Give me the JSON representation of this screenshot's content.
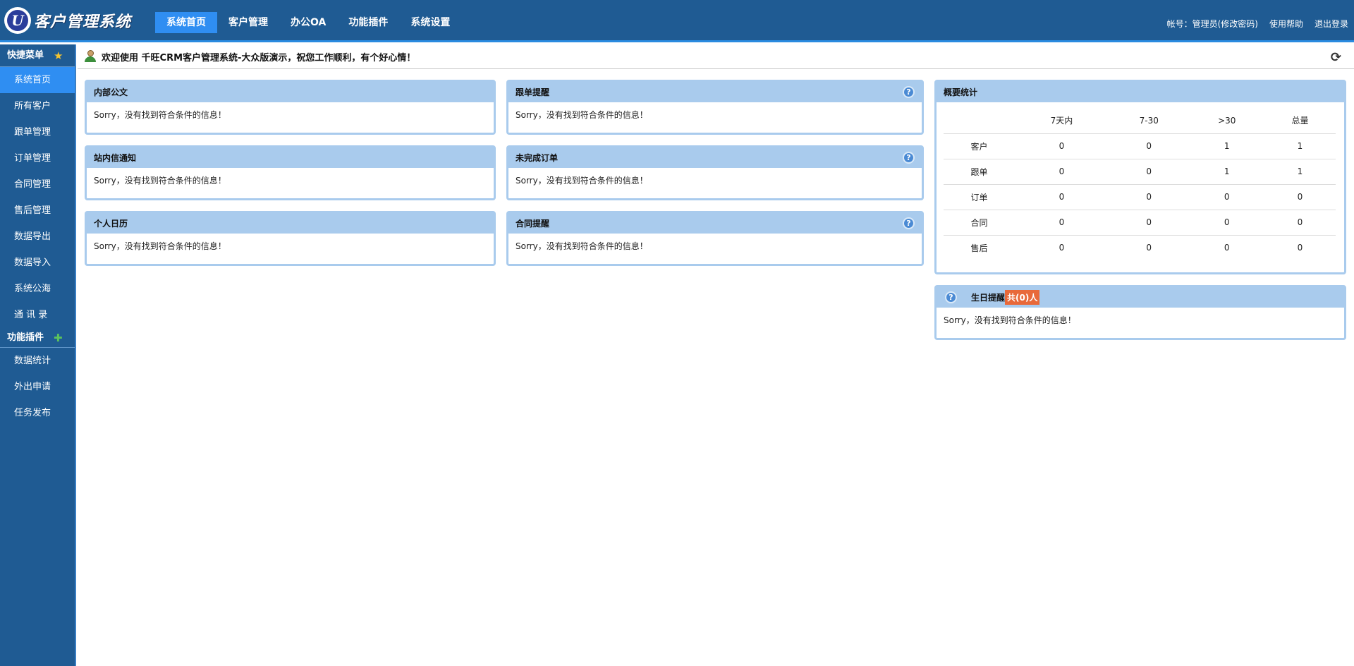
{
  "header": {
    "logo_text": "客户管理系统",
    "logo_letter": "U",
    "nav": [
      "系统首页",
      "客户管理",
      "办公OA",
      "功能插件",
      "系统设置"
    ],
    "account": "帐号：管理员(修改密码)",
    "help": "使用帮助",
    "logout": "退出登录"
  },
  "sidebar": {
    "quick_menu_title": "快捷菜单",
    "quick_items": [
      "系统首页",
      "所有客户",
      "跟单管理",
      "订单管理",
      "合同管理",
      "售后管理",
      "数据导出",
      "数据导入",
      "系统公海",
      "通 讯 录"
    ],
    "plugins_title": "功能插件",
    "plugin_items": [
      "数据统计",
      "外出申请",
      "任务发布"
    ]
  },
  "welcome": {
    "text": "欢迎使用 千旺CRM客户管理系统-大众版演示，祝您工作顺利，有个好心情！"
  },
  "panels": {
    "internal_docs": {
      "title": "内部公文",
      "body": "Sorry，没有找到符合条件的信息！"
    },
    "followup_reminder": {
      "title": "跟单提醒",
      "body": "Sorry，没有找到符合条件的信息！"
    },
    "site_messages": {
      "title": "站内信通知",
      "body": "Sorry，没有找到符合条件的信息！"
    },
    "unfinished_orders": {
      "title": "未完成订单",
      "body": "Sorry，没有找到符合条件的信息！"
    },
    "personal_calendar": {
      "title": "个人日历",
      "body": "Sorry，没有找到符合条件的信息！"
    },
    "contract_reminder": {
      "title": "合同提醒",
      "body": "Sorry，没有找到符合条件的信息！"
    },
    "birthday": {
      "title": "生日提醒",
      "badge": "共(0)人",
      "body": "Sorry，没有找到符合条件的信息！"
    }
  },
  "stats": {
    "title": "概要统计",
    "columns": [
      "",
      "7天内",
      "7-30",
      ">30",
      "总量"
    ],
    "rows": [
      [
        "客户",
        "0",
        "0",
        "1",
        "1"
      ],
      [
        "跟单",
        "0",
        "0",
        "1",
        "1"
      ],
      [
        "订单",
        "0",
        "0",
        "0",
        "0"
      ],
      [
        "合同",
        "0",
        "0",
        "0",
        "0"
      ],
      [
        "售后",
        "0",
        "0",
        "0",
        "0"
      ]
    ]
  },
  "icons": {
    "quick_menu": "star-icon",
    "plugins": "puzzle-icon",
    "help": "help-icon",
    "refresh": "refresh-icon",
    "user": "user-icon"
  },
  "colors": {
    "header_bg": "#1f5b93",
    "active": "#2f8ef2",
    "panel_head": "#a9cbed",
    "badge": "#e8693a"
  }
}
